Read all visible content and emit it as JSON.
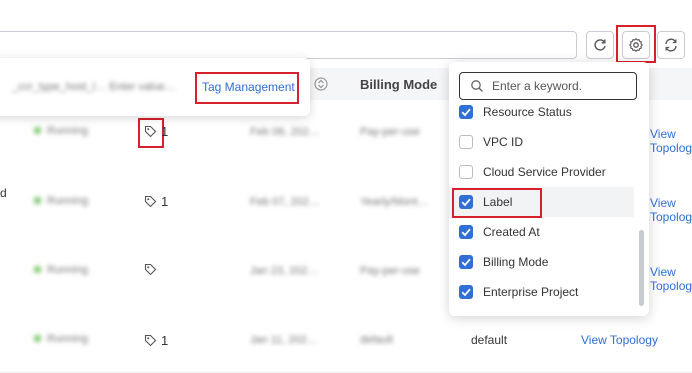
{
  "toolbar": {
    "settings_icon": "gear-icon",
    "refresh_icon": "refresh-icon",
    "reload_icon": "reload-icon"
  },
  "table": {
    "headers": {
      "billing": "Billing Mode"
    },
    "rows": [
      {
        "name_tail": "",
        "status": "Running",
        "tags": "1",
        "created": "Feb 08, 202…",
        "billing": "Pay-per-use",
        "action": "View Topology"
      },
      {
        "name_tail": "d",
        "status": "Running",
        "tags": "1",
        "created": "Feb 07, 202…",
        "billing": "Yearly/Mont…",
        "action": "View Topology"
      },
      {
        "name_tail": "",
        "status": "Running",
        "tags": "",
        "created": "Jan 23, 202…",
        "billing": "Pay-per-use",
        "action": "View Topology"
      },
      {
        "name_tail": "",
        "status": "Running",
        "tags": "1",
        "created": "Jan 11, 202…",
        "billing": "default",
        "action": "View Topology"
      }
    ]
  },
  "tag_popover": {
    "blurred_text": "_ccr_type_host_l…   Enter value…",
    "link": "Tag Management"
  },
  "column_settings": {
    "search_placeholder": "Enter a keyword.",
    "options": [
      {
        "label": "Resource Status",
        "checked": true
      },
      {
        "label": "VPC ID",
        "checked": false
      },
      {
        "label": "Cloud Service Provider",
        "checked": false
      },
      {
        "label": "Label",
        "checked": true
      },
      {
        "label": "Created At",
        "checked": true
      },
      {
        "label": "Billing Mode",
        "checked": true
      },
      {
        "label": "Enterprise Project",
        "checked": true
      }
    ]
  },
  "colors": {
    "accent": "#2f6fd6",
    "highlight": "#d7202b",
    "running": "#6cbf5a"
  }
}
